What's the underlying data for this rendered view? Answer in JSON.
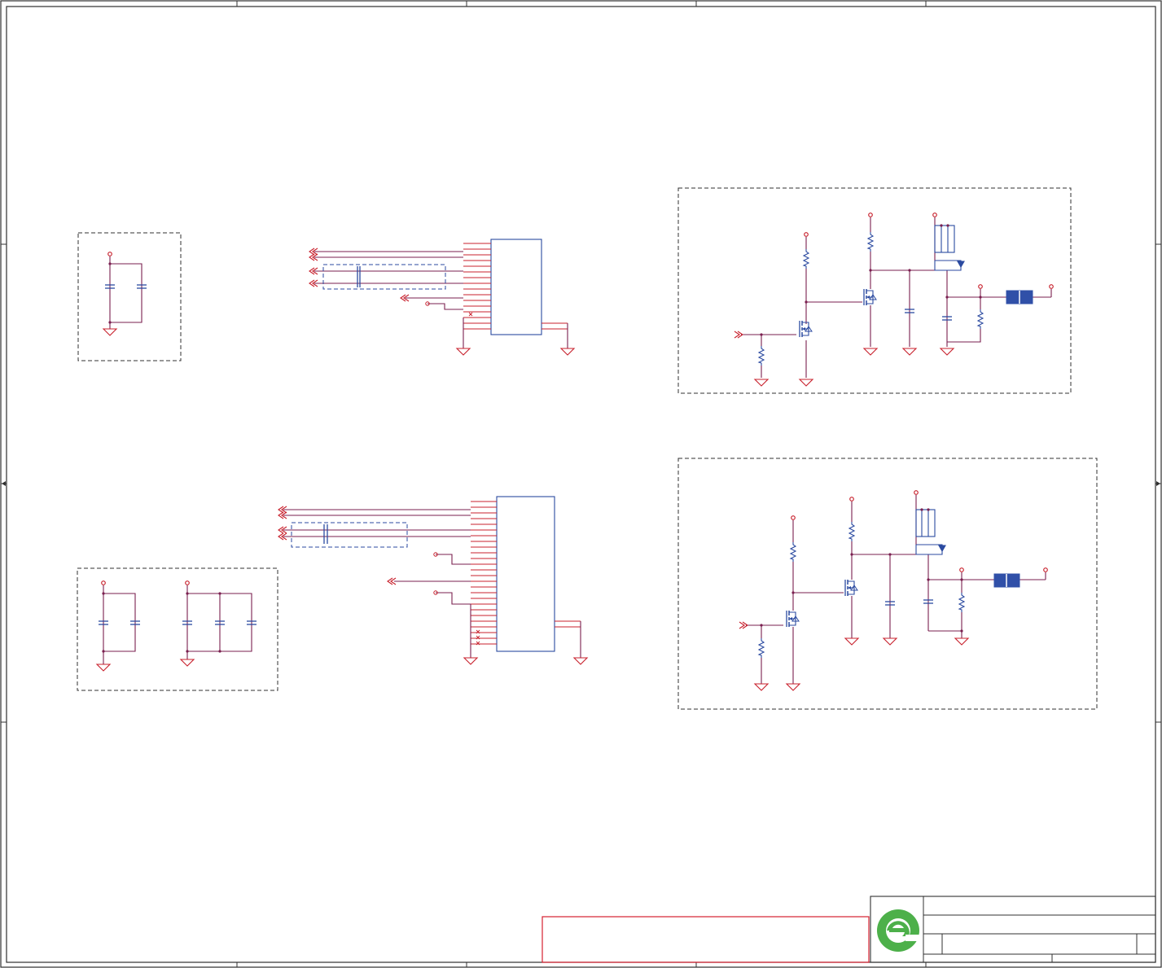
{
  "colors": {
    "border": "#3a3a3a",
    "wire": "#7a1f4f",
    "pin": "#c8202c",
    "part": "#2b4aa0",
    "net": "#6a2080",
    "frame": "#303030",
    "note": "#d62030",
    "logo": "#4db04a",
    "connector": "#3050a8"
  },
  "icons": {
    "logo": "company-logo",
    "ground": "ground-symbol",
    "capacitor": "capacitor-symbol",
    "resistor": "resistor-symbol",
    "mosfet": "mosfet-symbol"
  }
}
